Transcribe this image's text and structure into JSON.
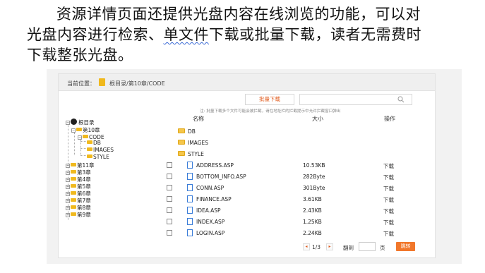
{
  "intro": {
    "line1": "资源详情页面还提供光盘内容在线浏览的功能，可以对",
    "line2_a": "光盘内容进行检索、",
    "line2_b": "单文件",
    "line2_c": "下载或批量下载，读者无需费时",
    "line3": "下载整张光盘。"
  },
  "breadcrumb": {
    "label": "当前位置：",
    "path": "根目录/第10章/CODE"
  },
  "toolbar": {
    "batch_download": "批量下载",
    "search_value": "",
    "hint": "注: 批量下载多个文件可能会被拦截，请在地址栏的拦截提示中允许拦截窗口弹出"
  },
  "tree": {
    "root": "根目录",
    "ch10": "第10章",
    "code": "CODE",
    "db": "DB",
    "images": "IMAGES",
    "style": "STYLE",
    "ch11": "第11章",
    "ch3": "第3章",
    "ch4": "第4章",
    "ch5": "第5章",
    "ch6": "第6章",
    "ch7": "第7章",
    "ch8": "第8章",
    "ch9": "第9章",
    "plus": "+",
    "minus": "−"
  },
  "table": {
    "headers": {
      "name": "名称",
      "size": "大小",
      "action": "操作"
    },
    "folders": [
      "DB",
      "IMAGES",
      "STYLE"
    ],
    "files": [
      {
        "name": "ADDRESS.ASP",
        "size": "10.53KB",
        "action": "下载"
      },
      {
        "name": "BOTTOM_INFO.ASP",
        "size": "282Byte",
        "action": "下载"
      },
      {
        "name": "CONN.ASP",
        "size": "301Byte",
        "action": "下载"
      },
      {
        "name": "FINANCE.ASP",
        "size": "3.61KB",
        "action": "下载"
      },
      {
        "name": "IDEA.ASP",
        "size": "2.43KB",
        "action": "下载"
      },
      {
        "name": "INDEX.ASP",
        "size": "1.25KB",
        "action": "下载"
      },
      {
        "name": "LOGIN.ASP",
        "size": "2.24KB",
        "action": "下载"
      }
    ]
  },
  "pager": {
    "prev": "◂",
    "current": "1/3",
    "next": "▸",
    "goto_label": "翻到",
    "page_value": "",
    "page_unit": "页",
    "go": "跳转"
  },
  "colors": {
    "accent": "#f1772b",
    "folder": "#f0b91e",
    "file": "#3b7dd8"
  }
}
